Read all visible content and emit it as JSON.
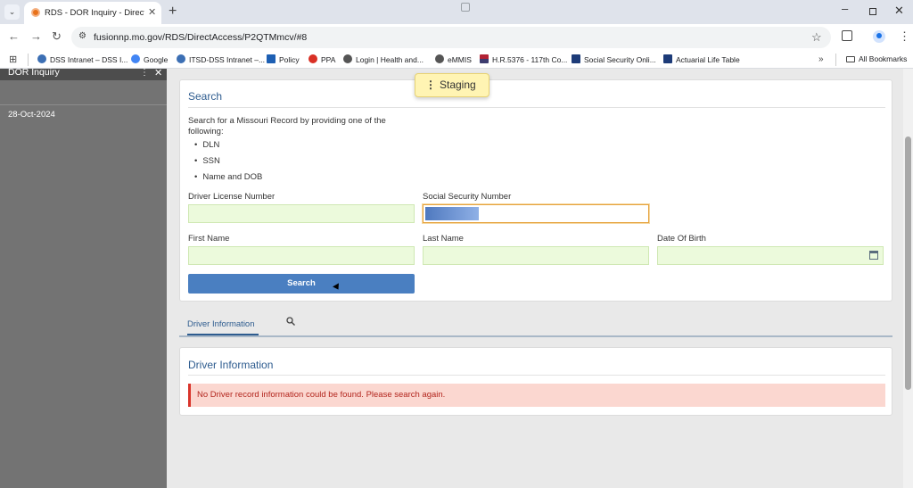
{
  "browser": {
    "tab_title": "RDS - DOR Inquiry - Direct Acce",
    "url": "fusionnp.mo.gov/RDS/DirectAccess/P2QTMmcv/#8",
    "bookmarks": [
      "DSS Intranet – DSS I...",
      "Google",
      "ITSD-DSS Intranet –...",
      "Policy",
      "PPA",
      "Login | Health and...",
      "eMMIS",
      "H.R.5376 - 117th Co...",
      "Social Security Onli...",
      "Actuarial Life Table"
    ],
    "more_bookmarks": "»",
    "all_bookmarks": "All Bookmarks"
  },
  "sidebar": {
    "title": "DOR Inquiry",
    "date": "28-Oct-2024"
  },
  "environment_badge": "Staging",
  "search_card": {
    "title": "Search",
    "intro": "Search for a Missouri Record by providing one of the following:",
    "options": [
      "DLN",
      "SSN",
      "Name and DOB"
    ],
    "fields": {
      "dln_label": "Driver License Number",
      "ssn_label": "Social Security Number",
      "first_name_label": "First Name",
      "last_name_label": "Last Name",
      "dob_label": "Date Of Birth"
    },
    "button": "Search"
  },
  "tabs": {
    "driver_information": "Driver Information"
  },
  "result_card": {
    "title": "Driver Information",
    "message": "No Driver record information could be found. Please search again."
  },
  "colors": {
    "accent": "#2e5c8f",
    "button": "#4a7fc1",
    "field_bg": "#ecfadc",
    "alert_bg": "#fbd7d0",
    "alert_border": "#d9342b"
  }
}
